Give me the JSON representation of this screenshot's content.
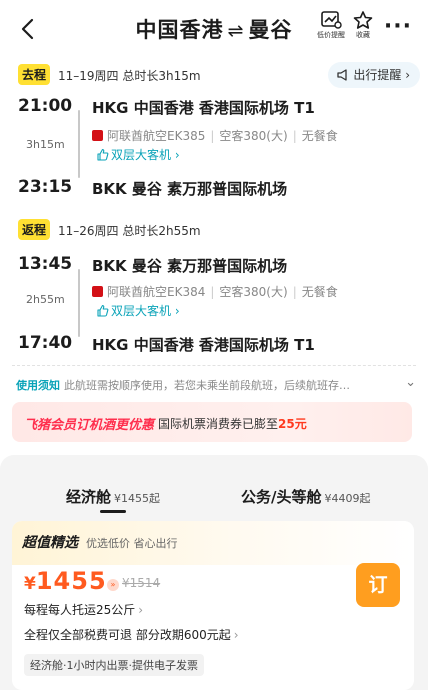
{
  "header": {
    "from": "中国香港",
    "swap": "⇌",
    "to": "曼谷",
    "price_alert_caption": "低价提醒",
    "favorite_caption": "收藏"
  },
  "outbound": {
    "tag": "去程",
    "meta": "11–19周四  总时长3h15m",
    "reminder": "出行提醒 ›",
    "dep_time": "21:00",
    "dep_place": "HKG 中国香港 香港国际机场 T1",
    "duration": "3h15m",
    "airline": "阿联酋航空EK385",
    "aircraft": "空客380(大)",
    "meal": "无餐食",
    "plane_type": "双层大客机 ›",
    "arr_time": "23:15",
    "arr_place": "BKK 曼谷 素万那普国际机场"
  },
  "return": {
    "tag": "返程",
    "meta": "11–26周四  总时长2h55m",
    "dep_time": "13:45",
    "dep_place": "BKK 曼谷 素万那普国际机场",
    "duration": "2h55m",
    "airline": "阿联酋航空EK384",
    "aircraft": "空客380(大)",
    "meal": "无餐食",
    "plane_type": "双层大客机 ›",
    "arr_time": "17:40",
    "arr_place": "HKG 中国香港 香港国际机场 T1"
  },
  "notice": {
    "label": "使用须知",
    "text": "此航班需按顺序使用，若您未乘坐前段航班，后续航班存…"
  },
  "banner": {
    "brand": "飞猪会员订机酒更优惠",
    "text": "国际机票消费券已膨至",
    "amount": "25元"
  },
  "cabins": {
    "economy": {
      "label": "经济舱",
      "price": "¥1455起"
    },
    "business": {
      "label": "公务/头等舱",
      "price": "¥4409起"
    }
  },
  "offer": {
    "title": "超值精选",
    "subtitle": "优选低价 省心出行",
    "currency": "¥",
    "price": "1455",
    "original_price": "¥1514",
    "book_label": "订",
    "baggage": "每程每人托运25公斤",
    "refund": "全程仅全部税费可退 部分改期600元起",
    "chip": "经济舱·1小时内出票·提供电子发票"
  },
  "colors": {
    "accent_teal": "#0aa3b8",
    "price_orange": "#ff5a1f",
    "book_button": "#ff9e1f",
    "tag_yellow": "#ffe033",
    "brand_red": "#ff2e4d"
  }
}
